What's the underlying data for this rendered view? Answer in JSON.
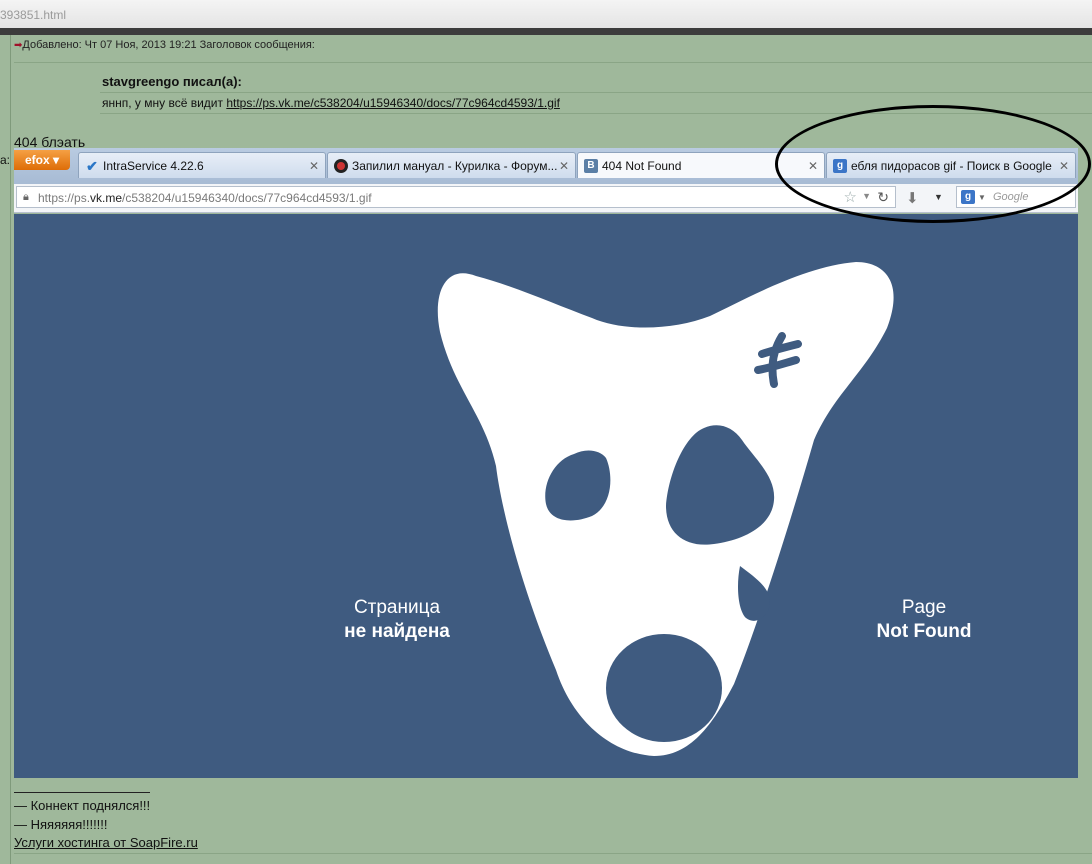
{
  "window": {
    "file_name": "393851.html"
  },
  "post": {
    "meta": "Добавлено: Чт 07 Ноя, 2013 19:21    Заголовок сообщения:",
    "quote_author": "stavgreengo писал(а):",
    "quote_text_prefix": "яннп, у мну всё видит ",
    "quote_link": "https://ps.vk.me/c538204/u15946340/docs/77c964cd4593/1.gif",
    "message": "404 блэать",
    "side_colon": "a:"
  },
  "browser": {
    "menu_button": "efox",
    "tabs": [
      {
        "label": "IntraService 4.22.6",
        "favicon": "checkmark-icon"
      },
      {
        "label": "Запилил мануал - Курилка - Форум...",
        "favicon": "forum-icon"
      },
      {
        "label": "404 Not Found",
        "favicon": "vk-icon",
        "active": true
      },
      {
        "label": "ебля пидорасов gif - Поиск в Google",
        "favicon": "google-icon"
      }
    ],
    "url_prefix": "https://ps.",
    "url_host": "vk.me",
    "url_path": "/c538204/u15946340/docs/77c964cd4593/1.gif",
    "search_placeholder": "Google",
    "search_engine_letter": "g",
    "vk_letter": "B",
    "close_glyph": "✕"
  },
  "error_page": {
    "ru_line1": "Страница",
    "ru_line2": "не найдена",
    "en_line1": "Page",
    "en_line2": "Not Found",
    "background_color": "#3f5b80"
  },
  "signature": {
    "line1": "— Коннект поднялся!!!",
    "line2": "— Няяяяяя!!!!!!!",
    "link": "Услуги хостинга от SoapFire.ru"
  }
}
